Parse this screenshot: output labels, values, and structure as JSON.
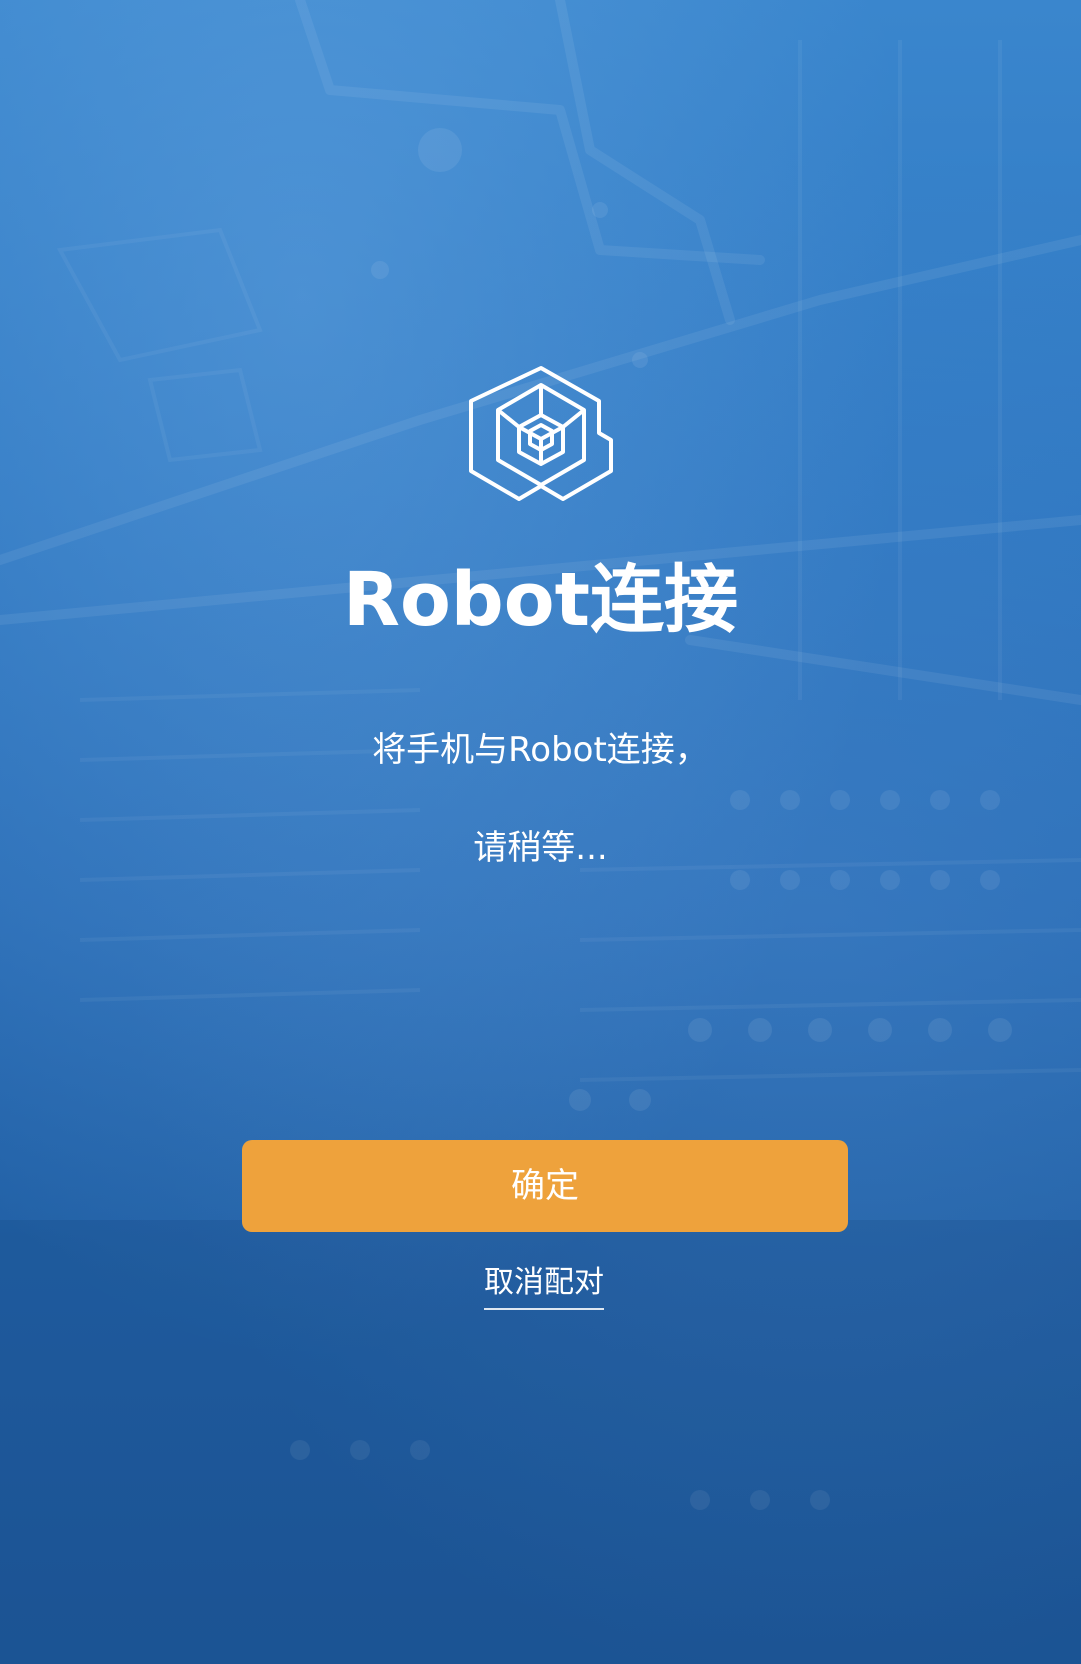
{
  "title": "Robot连接",
  "message_line1": "将手机与Robot连接，",
  "message_line2": "请稍等...",
  "confirm_label": "确定",
  "cancel_label": "取消配对",
  "colors": {
    "background": "#2f78c2",
    "button": "#eea23c",
    "text": "#ffffff"
  },
  "icons": {
    "logo": "hexagon-cube-logo-icon"
  }
}
